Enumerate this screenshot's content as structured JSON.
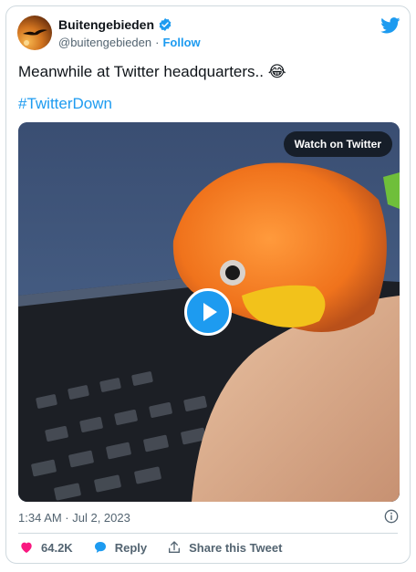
{
  "author": {
    "name": "Buitengebieden",
    "handle": "@buitengebieden",
    "separator": "·",
    "follow_label": "Follow"
  },
  "tweet": {
    "text": "Meanwhile at Twitter headquarters.. 😂",
    "hashtag": "#TwitterDown"
  },
  "media": {
    "watch_label": "Watch on Twitter"
  },
  "meta": {
    "timestamp": "1:34 AM · Jul 2, 2023"
  },
  "actions": {
    "likes": "64.2K",
    "reply_label": "Reply",
    "share_label": "Share this Tweet"
  },
  "colors": {
    "accent": "#1d9bf0",
    "like": "#f91880",
    "text_secondary": "#536471"
  },
  "icons": [
    "verified-badge-icon",
    "twitter-bird-icon",
    "play-icon",
    "info-icon",
    "heart-icon",
    "reply-bubble-icon",
    "share-icon"
  ]
}
